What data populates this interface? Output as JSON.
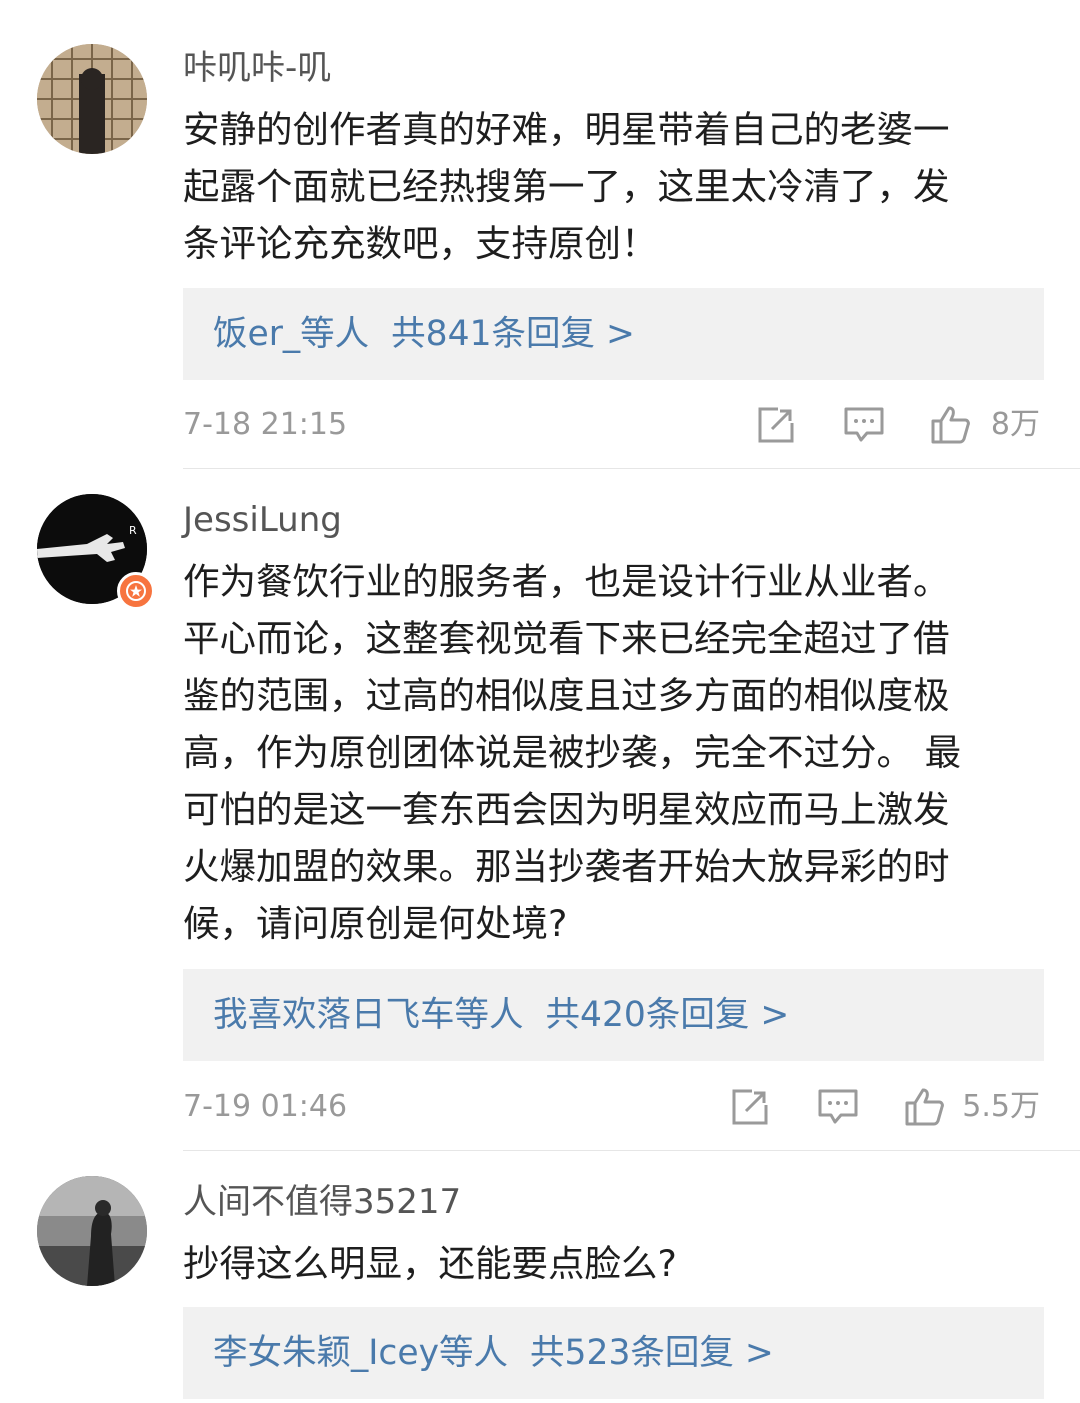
{
  "comments": [
    {
      "username": "咔叽咔-叽",
      "lines": [
        "安静的创作者真的好难，明星带着自己的老婆一",
        "起露个面就已经热搜第一了，这里太冷清了，发",
        "条评论充充数吧，支持原创！"
      ],
      "replies_users": "饭er_等人",
      "replies_total": "共841条回复 >",
      "time": "7-18 21:15",
      "likes": "8万"
    },
    {
      "username": "JessiLung",
      "lines": [
        "作为餐饮行业的服务者，也是设计行业从业者。",
        "平心而论，这整套视觉看下来已经完全超过了借",
        "鉴的范围，过高的相似度且过多方面的相似度极",
        "高，作为原创团体说是被抄袭，完全不过分。 最",
        "可怕的是这一套东西会因为明星效应而马上激发",
        "火爆加盟的效果。那当抄袭者开始大放异彩的时",
        "候，请问原创是何处境?"
      ],
      "replies_users": "我喜欢落日飞车等人",
      "replies_total": "共420条回复 >",
      "time": "7-19 01:46",
      "likes": "5.5万"
    },
    {
      "username": "人间不值得35217",
      "lines": [
        "抄得这么明显，还能要点脸么?"
      ],
      "replies_users": "李女朱颖_Icey等人",
      "replies_total": "共523条回复 >"
    }
  ],
  "icons": {
    "share": "share-icon",
    "comment": "comment-icon",
    "like": "thumbs-up-icon",
    "badge": "verified-badge-icon"
  },
  "colors": {
    "link": "#4a7aab",
    "meta": "#999999",
    "reply_bg": "#f1f1f1",
    "badge": "#f7743f"
  }
}
